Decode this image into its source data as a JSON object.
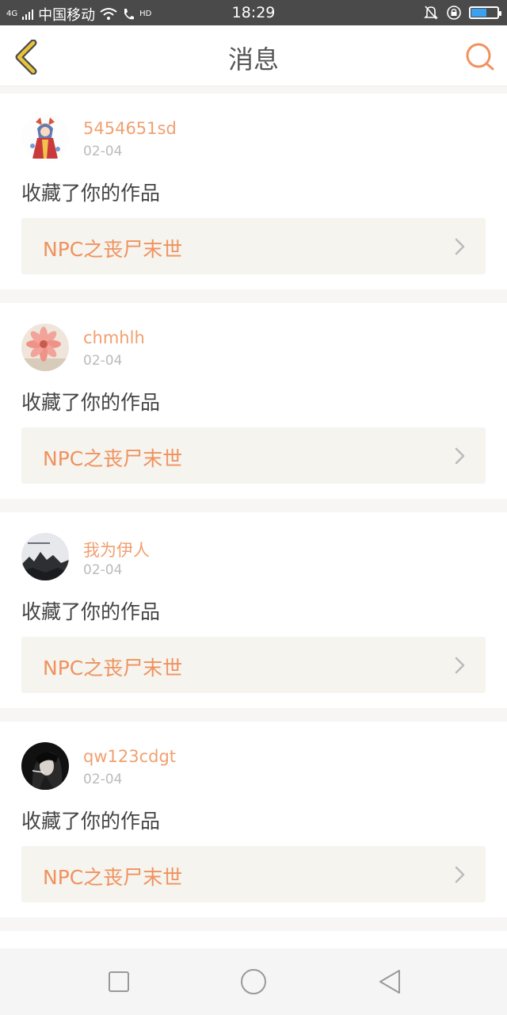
{
  "status_bar": {
    "network_type": "4G",
    "carrier": "中国移动",
    "hd_badge": "HD",
    "time": "18:29",
    "battery_level": 0.55,
    "icons": [
      "signal-icon",
      "wifi-icon",
      "call-icon",
      "mute-icon",
      "lock-rotation-icon",
      "battery-icon"
    ]
  },
  "header": {
    "title": "消息",
    "back_icon": "chevron-left-icon",
    "search_icon": "search-icon"
  },
  "colors": {
    "accent": "#f0925e",
    "username": "#f0a070",
    "back_icon": "#e8c43a"
  },
  "messages": [
    {
      "username": "5454651sd",
      "date": "02-04",
      "action": "收藏了你的作品",
      "work_title": "NPC之丧尸末世",
      "avatar": "anime-character-avatar"
    },
    {
      "username": "chmhlh",
      "date": "02-04",
      "action": "收藏了你的作品",
      "work_title": "NPC之丧尸末世",
      "avatar": "flower-avatar"
    },
    {
      "username": "我为伊人",
      "date": "02-04",
      "action": "收藏了你的作品",
      "work_title": "NPC之丧尸末世",
      "avatar": "landscape-avatar"
    },
    {
      "username": "qw123cdgt",
      "date": "02-04",
      "action": "收藏了你的作品",
      "work_title": "NPC之丧尸末世",
      "avatar": "person-avatar"
    }
  ],
  "system_nav": {
    "icons": [
      "recent-apps-icon",
      "home-icon",
      "back-icon"
    ]
  }
}
